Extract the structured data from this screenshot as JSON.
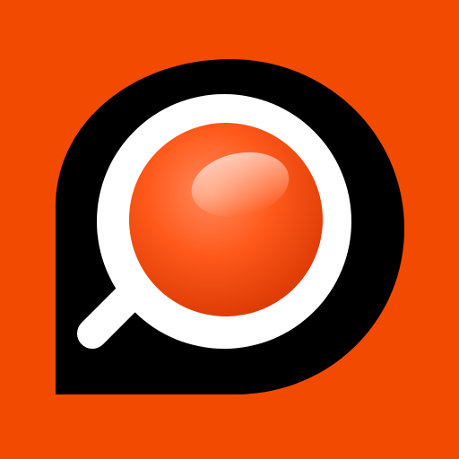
{
  "app_icon": {
    "name": "search-bubble-icon",
    "colors": {
      "background": "#f24a00",
      "bubble": "#000000",
      "ring": "#ffffff",
      "lens_highlight": "#ff7a4a",
      "lens_base": "#ff4f12",
      "lens_shadow": "#c92f00"
    }
  }
}
